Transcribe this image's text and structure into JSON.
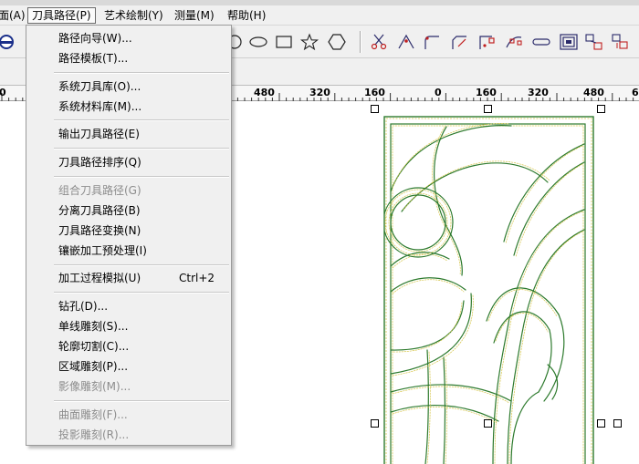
{
  "menubar": {
    "items": [
      {
        "label": "面(A)"
      },
      {
        "label": "刀具路径(P)"
      },
      {
        "label": "艺术绘制(Y)"
      },
      {
        "label": "测量(M)"
      },
      {
        "label": "帮助(H)"
      }
    ]
  },
  "toolbar": {
    "icons": [
      "circle-icon",
      "ellipse-icon",
      "rectangle-icon",
      "star-icon",
      "polygon-icon",
      "scissors-icon",
      "angle-icon",
      "corner-fillet-icon",
      "corner-chamfer-icon",
      "node-edit-icon",
      "curve-node-icon",
      "slot-icon",
      "offset-icon",
      "group-icon",
      "ungroup-icon"
    ]
  },
  "ruler": {
    "labels": [
      "0",
      "480",
      "320",
      "160",
      "0",
      "160",
      "320",
      "480",
      "6"
    ]
  },
  "dropdown": {
    "items": [
      {
        "label": "路径向导(W)...",
        "disabled": false
      },
      {
        "label": "路径模板(T)...",
        "disabled": false
      },
      {
        "label": "系统刀具库(O)...",
        "disabled": false
      },
      {
        "label": "系统材料库(M)...",
        "disabled": false
      },
      {
        "label": "输出刀具路径(E)",
        "disabled": false
      },
      {
        "label": "刀具路径排序(Q)",
        "disabled": false
      },
      {
        "label": "组合刀具路径(G)",
        "disabled": true
      },
      {
        "label": "分离刀具路径(B)",
        "disabled": false
      },
      {
        "label": "刀具路径变换(N)",
        "disabled": false
      },
      {
        "label": "镶嵌加工预处理(I)",
        "disabled": false
      },
      {
        "label": "加工过程模拟(U)",
        "shortcut": "Ctrl+2",
        "disabled": false
      },
      {
        "label": "钻孔(D)...",
        "disabled": false
      },
      {
        "label": "单线雕刻(S)...",
        "disabled": false
      },
      {
        "label": "轮廓切割(C)...",
        "disabled": false
      },
      {
        "label": "区域雕刻(P)...",
        "disabled": false
      },
      {
        "label": "影像雕刻(M)...",
        "disabled": true
      },
      {
        "label": "曲面雕刻(F)...",
        "disabled": true
      },
      {
        "label": "投影雕刻(R)...",
        "disabled": true
      }
    ]
  },
  "colors": {
    "menu_bg": "#f0f0f0",
    "disabled_text": "#8c8c8c",
    "toolbar_icon": "#2a2a6a",
    "toolpath_green": "#2d7a2d",
    "toolpath_yellow": "#d6c64a"
  }
}
